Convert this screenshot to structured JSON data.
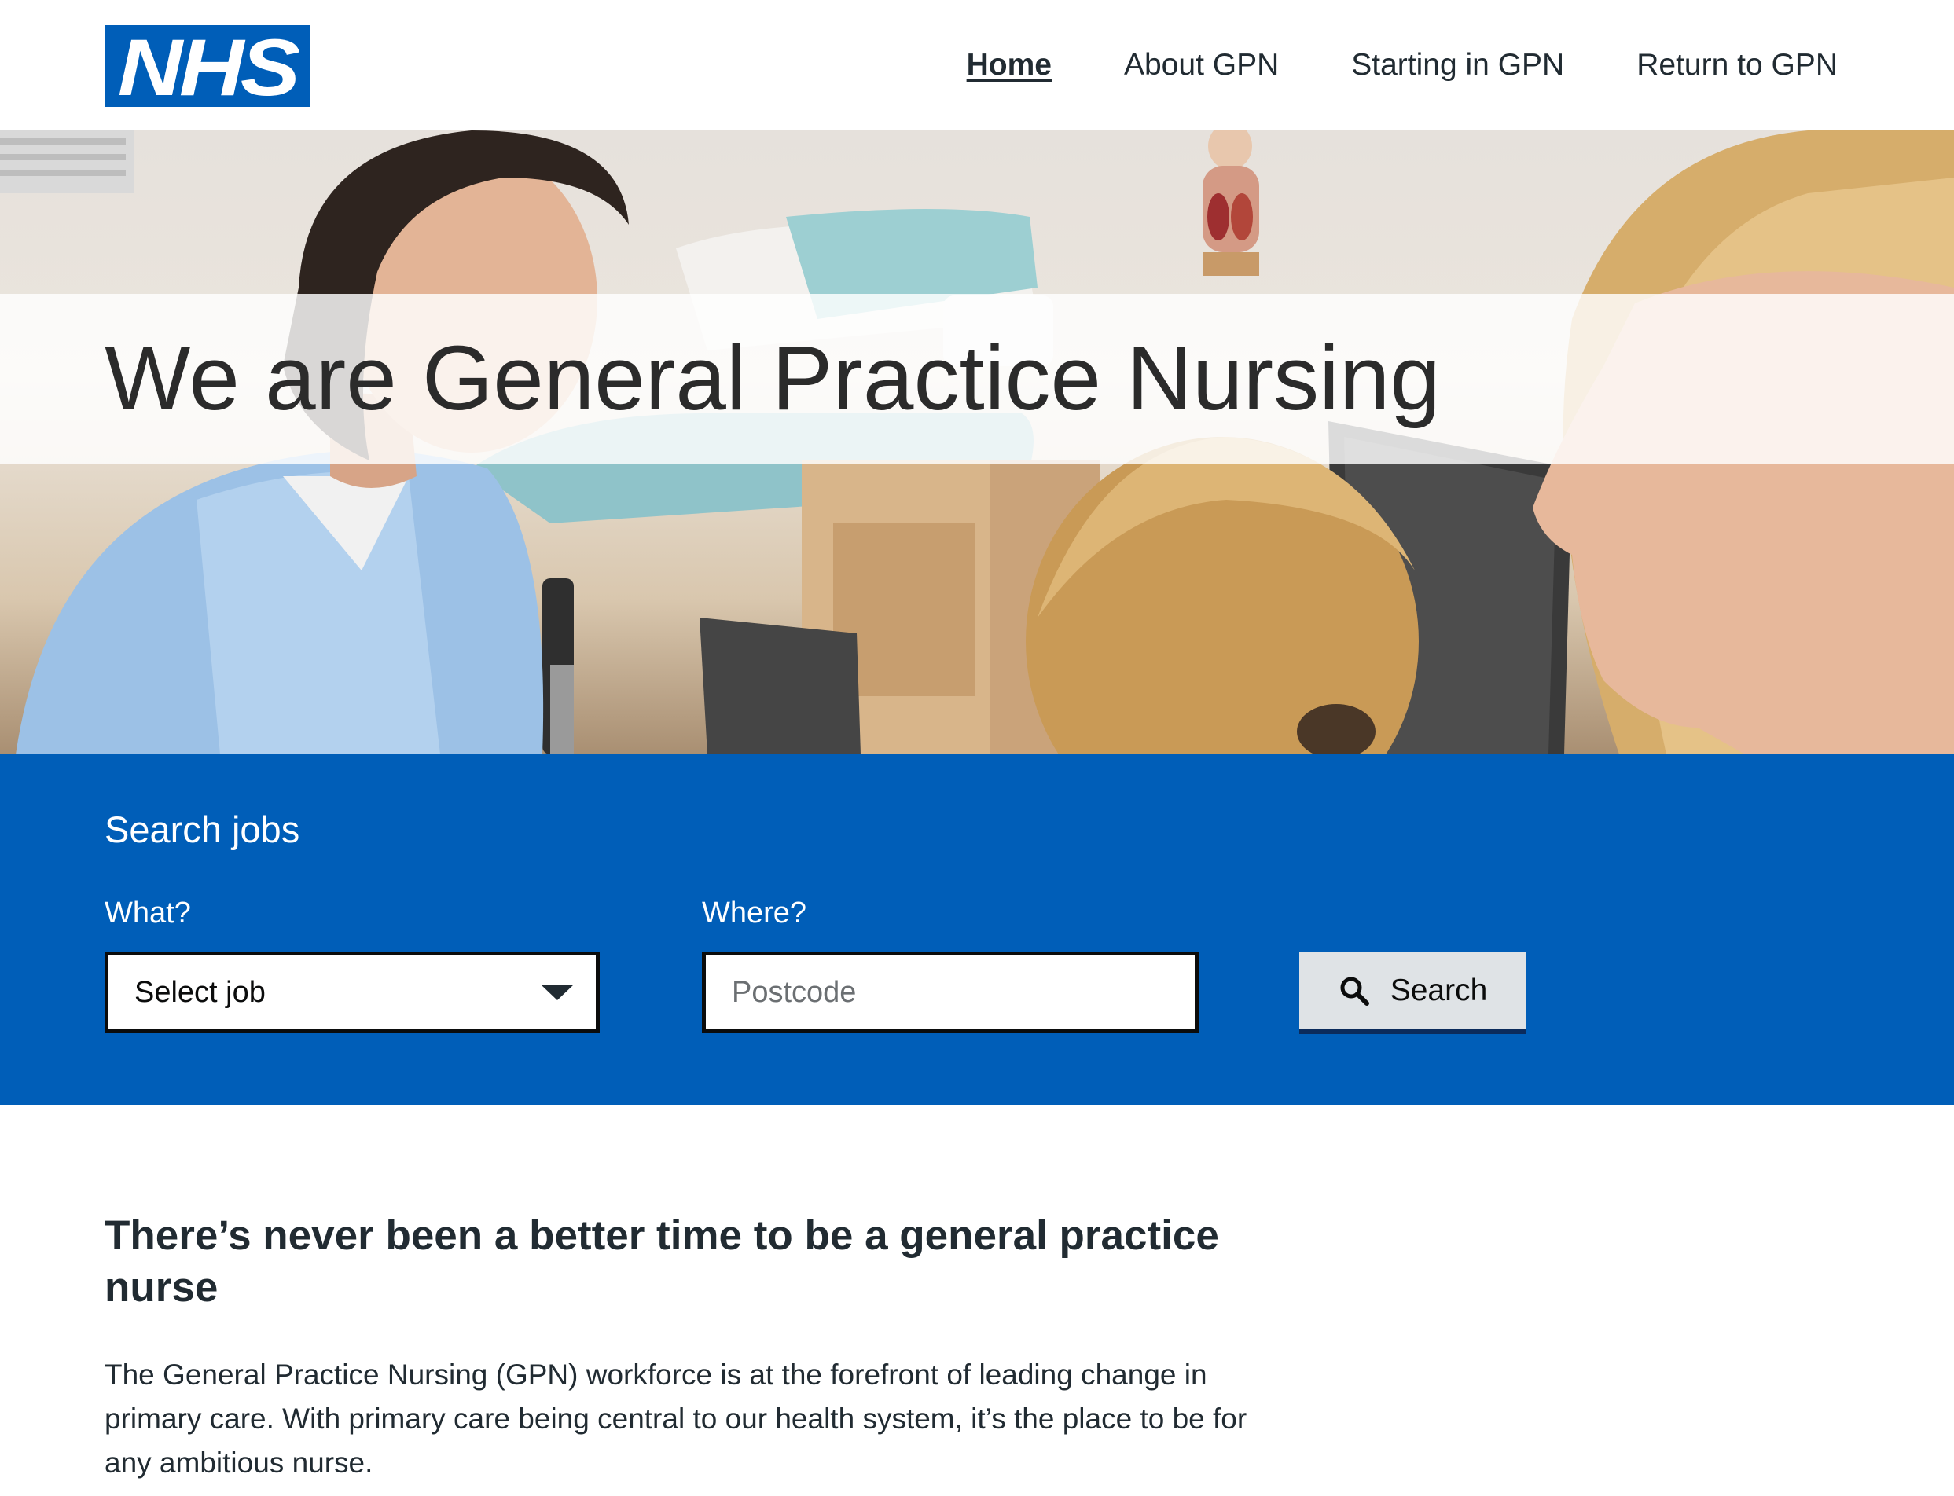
{
  "brand": {
    "logo_text": "NHS",
    "color": "#005eb8"
  },
  "nav": {
    "items": [
      {
        "label": "Home",
        "active": true
      },
      {
        "label": "About GPN",
        "active": false
      },
      {
        "label": "Starting in GPN",
        "active": false
      },
      {
        "label": "Return to GPN",
        "active": false
      }
    ]
  },
  "hero": {
    "title": "We are General Practice Nursing",
    "image": "nurse-consultation-photo"
  },
  "search": {
    "heading": "Search jobs",
    "what_label": "What?",
    "what_value": "Select job",
    "where_label": "Where?",
    "where_placeholder": "Postcode",
    "button_label": "Search",
    "button_icon": "search-icon",
    "panel_color": "#005eb8"
  },
  "content": {
    "heading": "There’s never been a better time to be a general practice nurse",
    "paragraph": "The General Practice Nursing (GPN) workforce is at the forefront of leading change in primary care. With primary care being central to our health system, it’s the place to be for any ambitious nurse."
  }
}
